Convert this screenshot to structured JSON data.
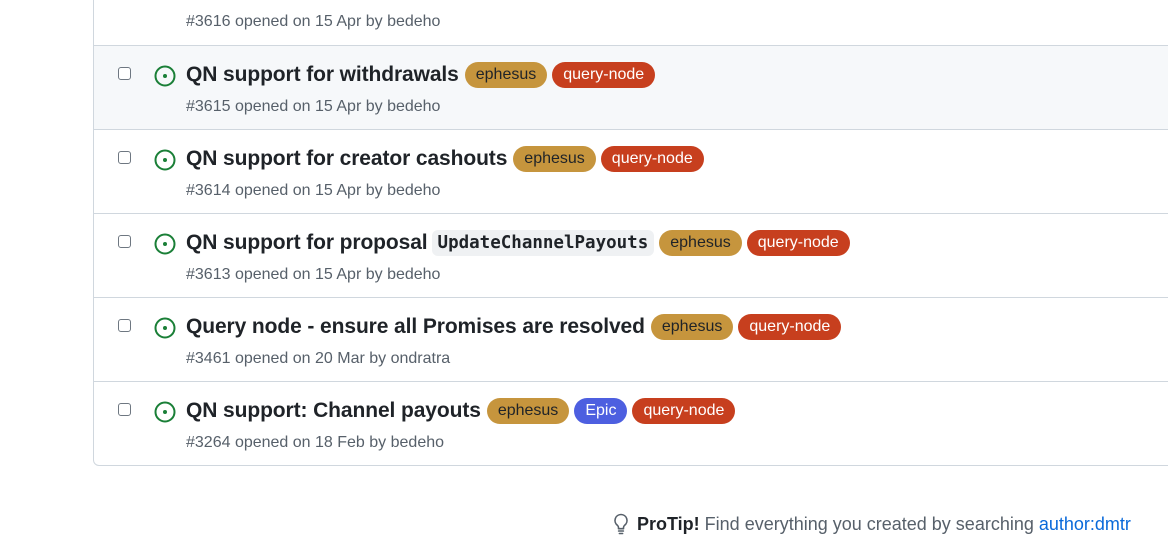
{
  "issues": [
    {
      "title": "",
      "code": "",
      "labels": [],
      "meta": "#3616 opened on 15 Apr by bedeho"
    },
    {
      "title": "QN support for withdrawals",
      "code": "",
      "labels": [
        "ephesus",
        "query-node"
      ],
      "meta": "#3615 opened on 15 Apr by bedeho"
    },
    {
      "title": "QN support for creator cashouts",
      "code": "",
      "labels": [
        "ephesus",
        "query-node"
      ],
      "meta": "#3614 opened on 15 Apr by bedeho"
    },
    {
      "title": "QN support for proposal",
      "code": "UpdateChannelPayouts",
      "labels": [
        "ephesus",
        "query-node"
      ],
      "meta": "#3613 opened on 15 Apr by bedeho"
    },
    {
      "title": "Query node - ensure all Promises are resolved",
      "code": "",
      "labels": [
        "ephesus",
        "query-node"
      ],
      "meta": "#3461 opened on 20 Mar by ondratra"
    },
    {
      "title": "QN support: Channel payouts",
      "code": "",
      "labels": [
        "ephesus",
        "Epic",
        "query-node"
      ],
      "meta": "#3264 opened on 18 Feb by bedeho"
    }
  ],
  "protip": {
    "heading": "ProTip!",
    "text": "Find everything you created by searching",
    "link": "author:dmtr"
  },
  "colors": {
    "open_icon": "#1a7f37",
    "label_ephesus": "#c6953d",
    "label_query_node": "#c73f1e",
    "label_epic": "#4d5fe0",
    "link": "#0969da"
  },
  "icons": {
    "status": "issue-opened-icon",
    "protip": "light-bulb-icon"
  }
}
